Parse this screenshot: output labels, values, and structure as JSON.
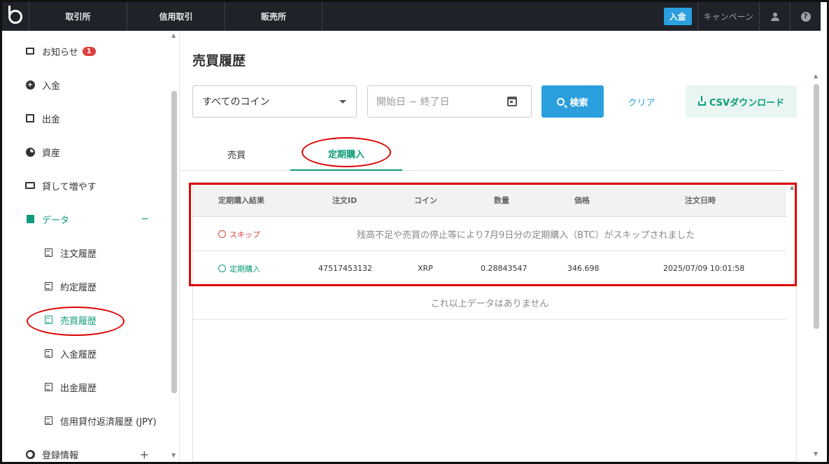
{
  "topbar": {
    "nav": [
      "取引所",
      "信用取引",
      "販売所"
    ],
    "deposit_label": "入金",
    "campaign_label": "キャンペーン",
    "help_glyph": "?"
  },
  "sidebar": {
    "notice_label": "お知らせ",
    "notice_badge": "1",
    "deposit_label": "入金",
    "withdraw_label": "出金",
    "assets_label": "資産",
    "lend_label": "貸して増やす",
    "data_label": "データ",
    "data_toggle": "−",
    "sub_items": [
      "注文履歴",
      "約定履歴",
      "売買履歴",
      "入金履歴",
      "出金履歴",
      "信用貸付返済履歴 (JPY)"
    ],
    "account_label": "登録情報",
    "account_toggle": "+"
  },
  "main": {
    "title": "売買履歴",
    "coin_select": "すべてのコイン",
    "date_placeholder": "開始日 − 終了日",
    "search_label": "検索",
    "clear_label": "クリア",
    "csv_label": "CSVダウンロード",
    "tabs": [
      "売買",
      "定期購入"
    ],
    "active_tab": "定期購入"
  },
  "table": {
    "headers": [
      "定期購入結果",
      "注文ID",
      "コイン",
      "数量",
      "価格",
      "注文日時"
    ],
    "skip_row": {
      "status": "スキップ",
      "message": "残高不足や売買の停止等により7月9日分の定期購入（BTC）がスキップされました"
    },
    "purchase_row": {
      "status": "定期購入",
      "order_id": "47517453132",
      "coin": "XRP",
      "quantity": "0.28843547",
      "price": "346.698",
      "datetime": "2025/07/09 10:01:58"
    },
    "no_more": "これ以上データはありません"
  },
  "colors": {
    "accent_teal": "#0e9b7a",
    "accent_blue": "#2b9fde",
    "skip_red": "#e03e3e",
    "topbar_bg": "#1f2329",
    "annotation_red": "#dd0000"
  },
  "icons": {
    "logo": "brand-logo-icon",
    "notice": "message-icon",
    "deposit": "plus-circle-icon",
    "withdraw": "wallet-icon",
    "assets": "pie-chart-icon",
    "lend": "lending-icon",
    "data": "clipboard-icon",
    "doc": "document-icon",
    "account": "account-circle-icon",
    "search": "search-icon",
    "calendar": "calendar-icon",
    "download": "download-icon",
    "skip": "alert-circle-icon",
    "clock": "clock-icon"
  }
}
